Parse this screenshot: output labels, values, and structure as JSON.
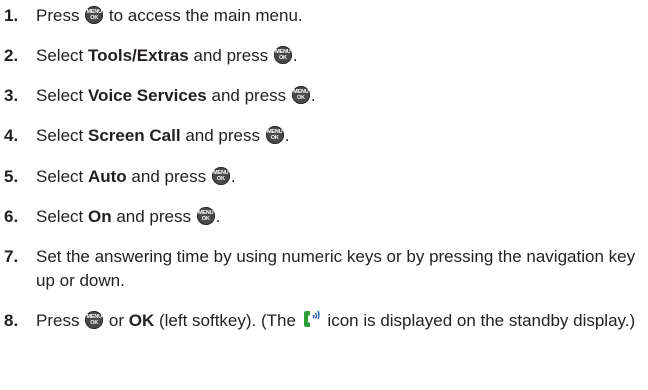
{
  "steps": [
    {
      "num": "1.",
      "parts": [
        {
          "t": "Press "
        },
        {
          "key": "menu"
        },
        {
          "t": " to access the main menu."
        }
      ]
    },
    {
      "num": "2.",
      "parts": [
        {
          "t": "Select "
        },
        {
          "b": "Tools/Extras"
        },
        {
          "t": " and press "
        },
        {
          "key": "menu"
        },
        {
          "t": "."
        }
      ]
    },
    {
      "num": "3.",
      "parts": [
        {
          "t": "Select "
        },
        {
          "b": "Voice Services"
        },
        {
          "t": " and press "
        },
        {
          "key": "menu"
        },
        {
          "t": "."
        }
      ]
    },
    {
      "num": "4.",
      "parts": [
        {
          "t": "Select "
        },
        {
          "b": "Screen Call"
        },
        {
          "t": " and press "
        },
        {
          "key": "menu"
        },
        {
          "t": "."
        }
      ]
    },
    {
      "num": "5.",
      "parts": [
        {
          "t": "Select "
        },
        {
          "b": "Auto"
        },
        {
          "t": " and press "
        },
        {
          "key": "menu"
        },
        {
          "t": "."
        }
      ]
    },
    {
      "num": "6.",
      "parts": [
        {
          "t": "Select "
        },
        {
          "b": "On"
        },
        {
          "t": " and press "
        },
        {
          "key": "menu"
        },
        {
          "t": "."
        }
      ]
    },
    {
      "num": "7.",
      "parts": [
        {
          "t": "Set the answering time by using numeric keys or by pressing the navigation key up or down."
        }
      ]
    },
    {
      "num": "8.",
      "parts": [
        {
          "t": "Press "
        },
        {
          "key": "menu"
        },
        {
          "t": " or "
        },
        {
          "b": "OK"
        },
        {
          "t": " (left softkey). (The "
        },
        {
          "icon": "screen-call-icon"
        },
        {
          "t": " icon is displayed on the standby display.)"
        }
      ]
    }
  ],
  "menu_key": {
    "line1": "MENU",
    "line2": "OK",
    "icon": "menu-ok-key-icon"
  },
  "colors": {
    "text": "#231f20",
    "key": "#4a4a4a",
    "call_icon_green": "#2e9e3a",
    "call_icon_blue": "#1f5fb0"
  }
}
